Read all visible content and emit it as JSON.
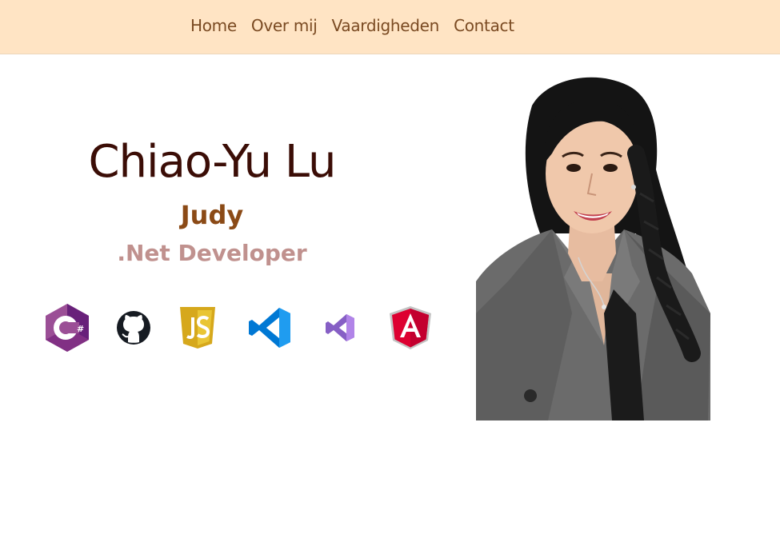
{
  "nav": {
    "items": [
      {
        "label": "Home"
      },
      {
        "label": "Over mij"
      },
      {
        "label": "Vaardigheden"
      },
      {
        "label": "Contact"
      }
    ],
    "background": "#ffe4c4",
    "text_color": "#7a4a22"
  },
  "hero": {
    "name": "Chiao-Yu Lu",
    "nickname": "Judy",
    "role": ".Net Developer"
  },
  "skills": [
    {
      "icon": "csharp-icon"
    },
    {
      "icon": "github-icon"
    },
    {
      "icon": "javascript-icon"
    },
    {
      "icon": "vscode-icon"
    },
    {
      "icon": "visual-studio-icon"
    },
    {
      "icon": "angular-icon"
    }
  ],
  "colors": {
    "name": "#3b0d06",
    "nickname": "#8b4a16",
    "role": "#c0918e"
  }
}
